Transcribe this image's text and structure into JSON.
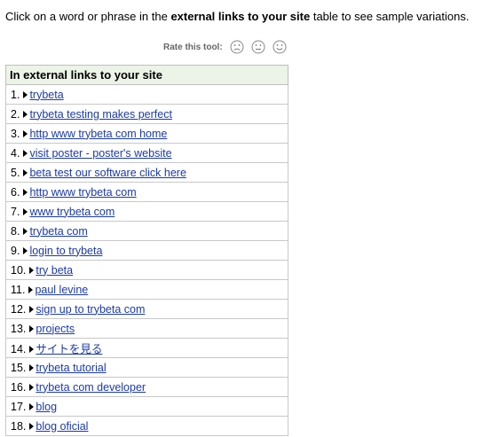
{
  "intro": {
    "prefix": "Click on a word or phrase in the ",
    "bold": "external links to your site",
    "suffix": " table to see sample variations."
  },
  "rate": {
    "label": "Rate this tool:"
  },
  "table": {
    "header": "In external links to your site",
    "rows": [
      {
        "num": "1.",
        "text": "trybeta"
      },
      {
        "num": "2.",
        "text": "trybeta testing makes perfect"
      },
      {
        "num": "3.",
        "text": "http www trybeta com home"
      },
      {
        "num": "4.",
        "text": "visit poster - poster's website"
      },
      {
        "num": "5.",
        "text": "beta test our software click here"
      },
      {
        "num": "6.",
        "text": "http www trybeta com"
      },
      {
        "num": "7.",
        "text": "www trybeta com"
      },
      {
        "num": "8.",
        "text": "trybeta com"
      },
      {
        "num": "9.",
        "text": "login to trybeta"
      },
      {
        "num": "10.",
        "text": "try beta"
      },
      {
        "num": "11.",
        "text": "paul levine"
      },
      {
        "num": "12.",
        "text": "sign up to trybeta com"
      },
      {
        "num": "13.",
        "text": "projects"
      },
      {
        "num": "14.",
        "text": "サイトを見る"
      },
      {
        "num": "15.",
        "text": "trybeta tutorial"
      },
      {
        "num": "16.",
        "text": "trybeta com developer"
      },
      {
        "num": "17.",
        "text": "blog"
      },
      {
        "num": "18.",
        "text": "blog oficial"
      }
    ]
  }
}
